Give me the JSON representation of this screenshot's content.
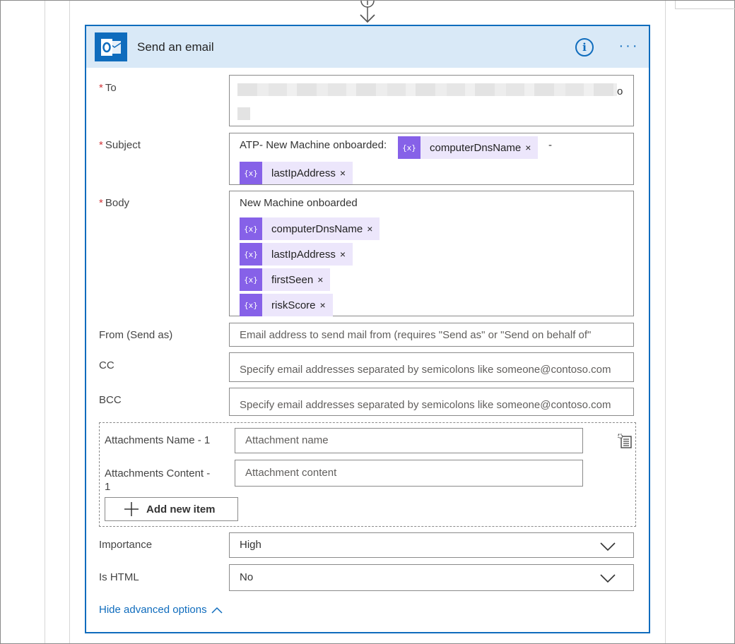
{
  "card": {
    "title": "Send an email",
    "icon": "outlook-icon",
    "accent_color": "#0f6cbd",
    "header_bg": "#d9e9f7"
  },
  "required_marker": "*",
  "fields": {
    "to": {
      "label": "To",
      "required": true,
      "value_visible": "o",
      "note": "value blurred"
    },
    "subject": {
      "label": "Subject",
      "required": true,
      "prefix_text": "ATP- New Machine onboarded:",
      "tokens": [
        "computerDnsName",
        "lastIpAddress"
      ],
      "separator": "-"
    },
    "body": {
      "label": "Body",
      "required": true,
      "text": "New Machine onboarded",
      "tokens": [
        "computerDnsName",
        "lastIpAddress",
        "firstSeen",
        "riskScore"
      ]
    },
    "from": {
      "label": "From (Send as)",
      "placeholder": "Email address to send mail from (requires \"Send as\" or \"Send on behalf of\""
    },
    "cc": {
      "label": "CC",
      "placeholder": "Specify email addresses separated by semicolons like someone@contoso.com"
    },
    "bcc": {
      "label": "BCC",
      "placeholder": "Specify email addresses separated by semicolons like someone@contoso.com"
    }
  },
  "attachments": {
    "name_label": "Attachments Name - 1",
    "name_placeholder": "Attachment name",
    "content_label_line1": "Attachments Content -",
    "content_label_line2": "1",
    "content_placeholder": "Attachment content",
    "add_item_label": "Add new item"
  },
  "importance": {
    "label": "Importance",
    "value": "High"
  },
  "is_html": {
    "label": "Is HTML",
    "value": "No"
  },
  "token_icon_glyph": "{x}",
  "token_remove_glyph": "×",
  "hide_advanced_label": "Hide advanced options",
  "token_colors": {
    "icon_bg": "#8661e8",
    "chip_bg": "#ece6fb"
  }
}
